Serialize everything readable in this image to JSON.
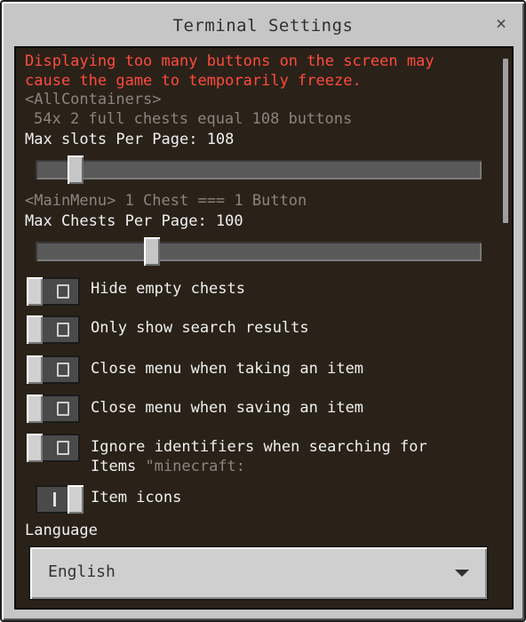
{
  "window": {
    "title": "Terminal Settings",
    "close_symbol": "×"
  },
  "warning": {
    "line1": "Displaying too many buttons on the screen may",
    "line2": "cause the game to temporarily freeze."
  },
  "all_containers": {
    "header": "<AllContainers>",
    "hint": "54x 2 full chests equal 108 buttons",
    "label": "Max slots Per Page: 108",
    "value": 108
  },
  "main_menu": {
    "hint": "<MainMenu> 1 Chest === 1 Button",
    "label": "Max Chests Per Page: 100",
    "value": 100
  },
  "options": [
    {
      "label": "Hide empty chests",
      "on": false
    },
    {
      "label": "Only show search results",
      "on": false
    },
    {
      "label": "Close menu when taking an item",
      "on": false
    },
    {
      "label": "Close menu when saving an item",
      "on": false
    },
    {
      "label": "Ignore identifiers when searching for",
      "label2": "Items",
      "suffix": "\"minecraft:",
      "on": false
    },
    {
      "label": "Item icons",
      "on": true
    }
  ],
  "language": {
    "label": "Language",
    "value": "English"
  },
  "colors": {
    "warning": "#ff4b3e",
    "panel": "#2a2219",
    "frame": "#c6c6c6"
  }
}
